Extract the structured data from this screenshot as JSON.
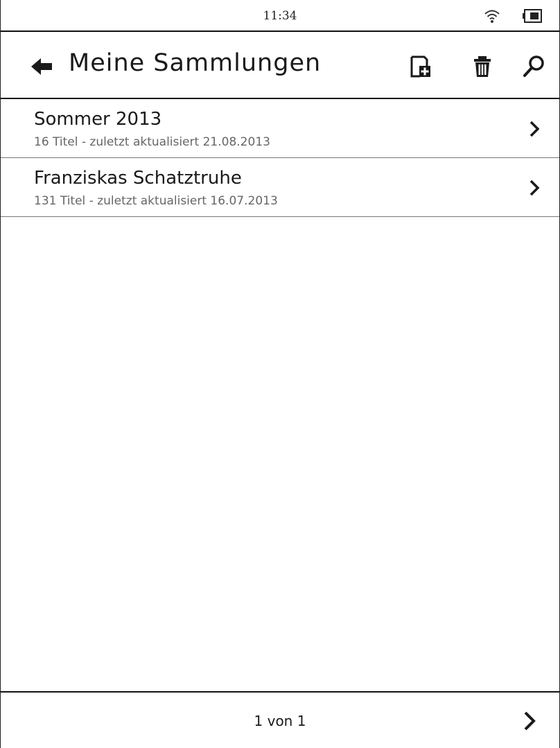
{
  "status_bar": {
    "time": "11:34",
    "wifi_icon": "wifi-icon",
    "battery_icon": "battery-icon"
  },
  "header": {
    "title": "Meine Sammlungen",
    "back_icon": "back-arrow-icon",
    "add_icon": "add-collection-icon",
    "delete_icon": "trash-icon",
    "search_icon": "search-icon"
  },
  "collections": [
    {
      "title": "Sommer 2013",
      "subtitle": "16 Titel - zuletzt aktualisiert 21.08.2013"
    },
    {
      "title": "Franziskas Schatztruhe",
      "subtitle": "131 Titel - zuletzt aktualisiert 16.07.2013"
    }
  ],
  "footer": {
    "page_indicator": "1 von 1",
    "next_icon": "chevron-right-icon"
  }
}
